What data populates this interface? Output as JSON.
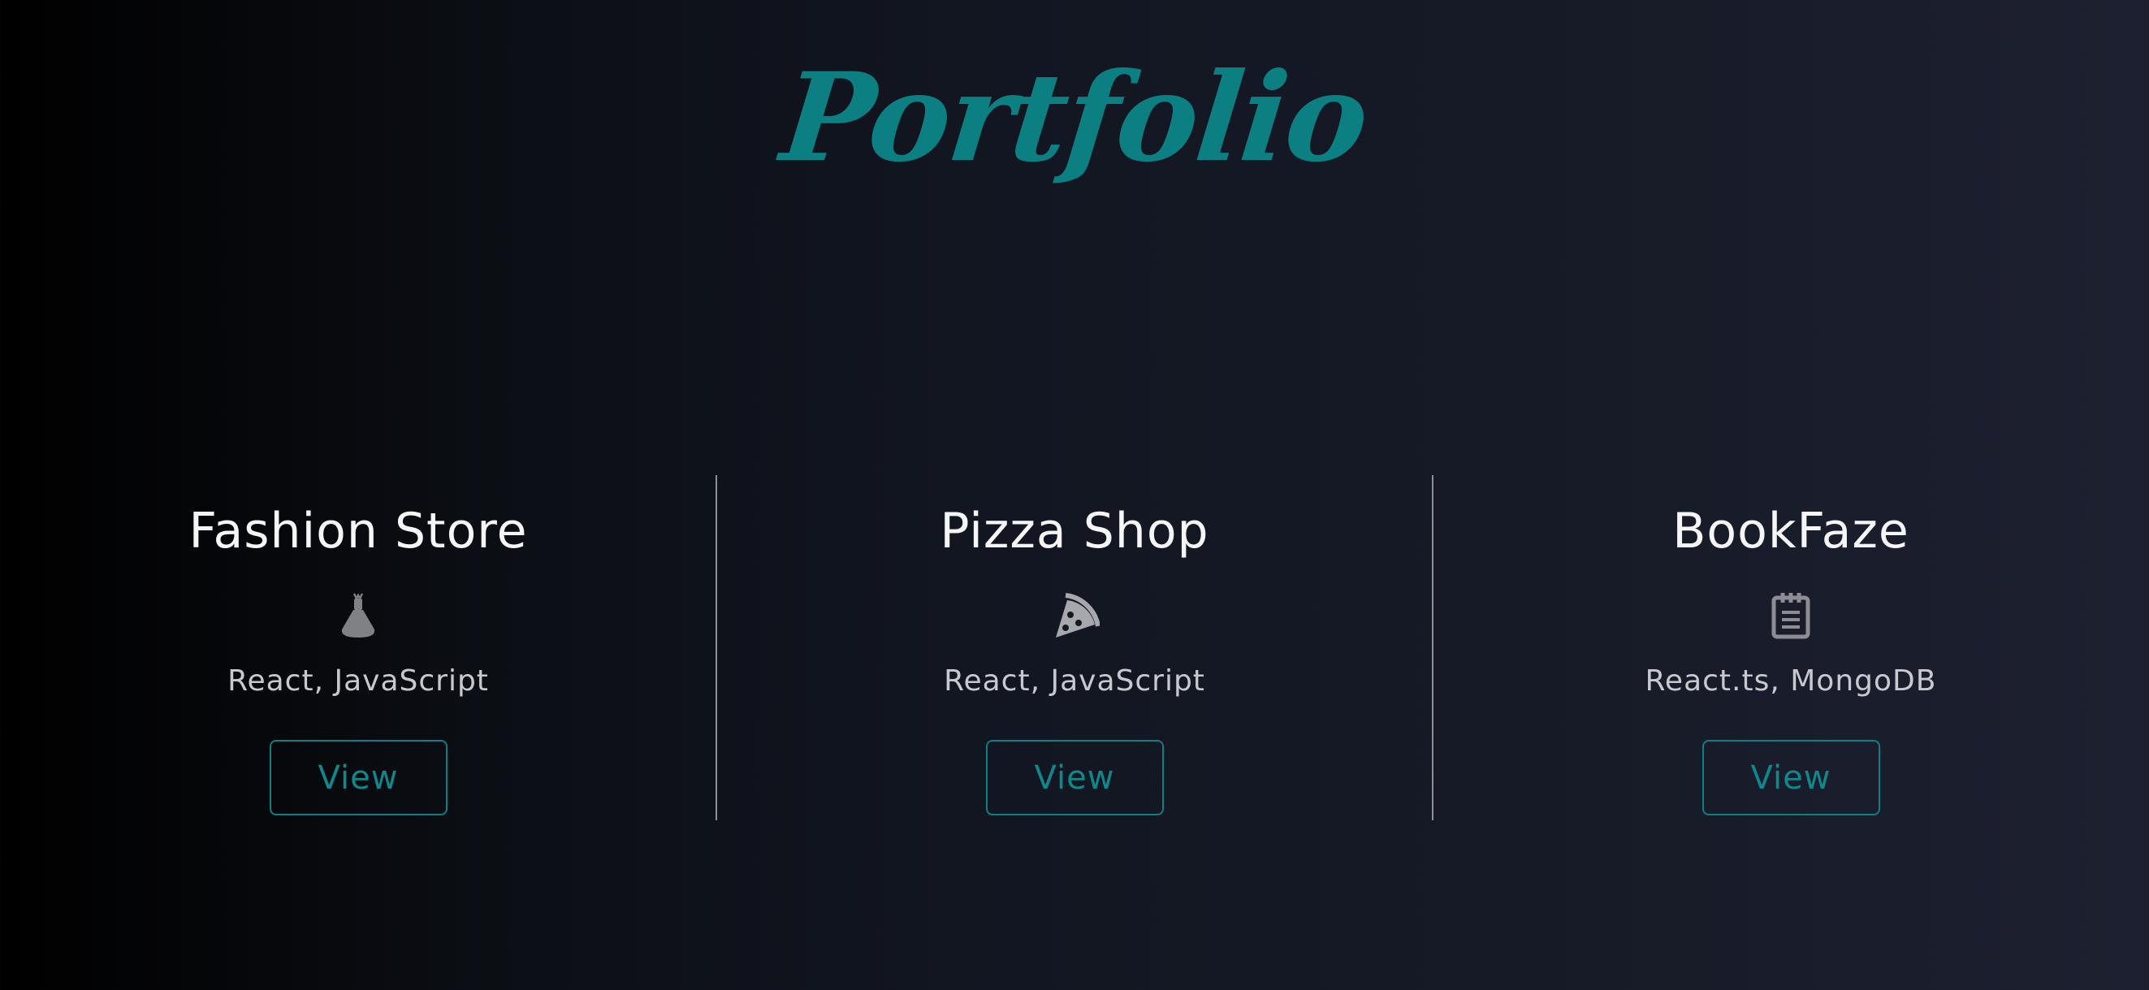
{
  "page": {
    "title": "Portfolio",
    "accent_color": "#0c7f82"
  },
  "projects": [
    {
      "title": "Fashion Store",
      "icon": "dress-icon",
      "tech": "React, JavaScript",
      "button_label": "View"
    },
    {
      "title": "Pizza Shop",
      "icon": "pizza-slice-icon",
      "tech": "React, JavaScript",
      "button_label": "View"
    },
    {
      "title": "BookFaze",
      "icon": "notepad-icon",
      "tech": "React.ts, MongoDB",
      "button_label": "View"
    }
  ]
}
